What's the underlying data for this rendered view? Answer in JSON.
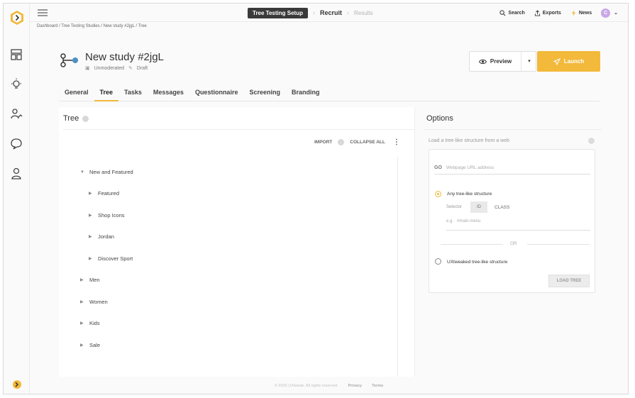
{
  "topbar": {
    "steps": [
      "Tree Testing Setup",
      "Recruit",
      "Results"
    ],
    "search_label": "Search",
    "exports_label": "Exports",
    "news_label": "News",
    "avatar_initial": "C"
  },
  "breadcrumb": "Dashboard / Tree Testing Studies / New study #2jgL / Tree",
  "study": {
    "title": "New study #2jgL",
    "mode": "Unmoderated",
    "status": "Draft"
  },
  "actions": {
    "preview_label": "Preview",
    "launch_label": "Launch"
  },
  "tabs": [
    "General",
    "Tree",
    "Tasks",
    "Messages",
    "Questionnaire",
    "Screening",
    "Branding"
  ],
  "active_tab": "Tree",
  "tree": {
    "heading": "Tree",
    "import_label": "IMPORT",
    "collapse_label": "COLLAPSE ALL",
    "nodes": [
      "New and Featured",
      "Featured",
      "Shop Icons",
      "Jordan",
      "Discover Sport",
      "Men",
      "Women",
      "Kids",
      "Sale"
    ]
  },
  "options": {
    "heading": "Options",
    "subtitle": "Load a tree-like structure from a web",
    "url_placeholder": "Webpage URL address",
    "go_label": "GO",
    "radio_any": "Any tree-like structure",
    "selector_label": "Selector",
    "id_label": "ID",
    "class_label": "CLASS",
    "eg_label": "e.g.",
    "eg_placeholder": "#main-menu",
    "or_label": "OR",
    "radio_uxtweak": "UXtweaked tree-like structure",
    "load_button": "LOAD TREE"
  },
  "footer": {
    "copyright": "© 2025 UXtweak. All rights reserved.",
    "privacy": "Privacy",
    "terms": "Terms"
  },
  "colors": {
    "accent": "#f2b93b",
    "dark": "#3a3a3a"
  }
}
